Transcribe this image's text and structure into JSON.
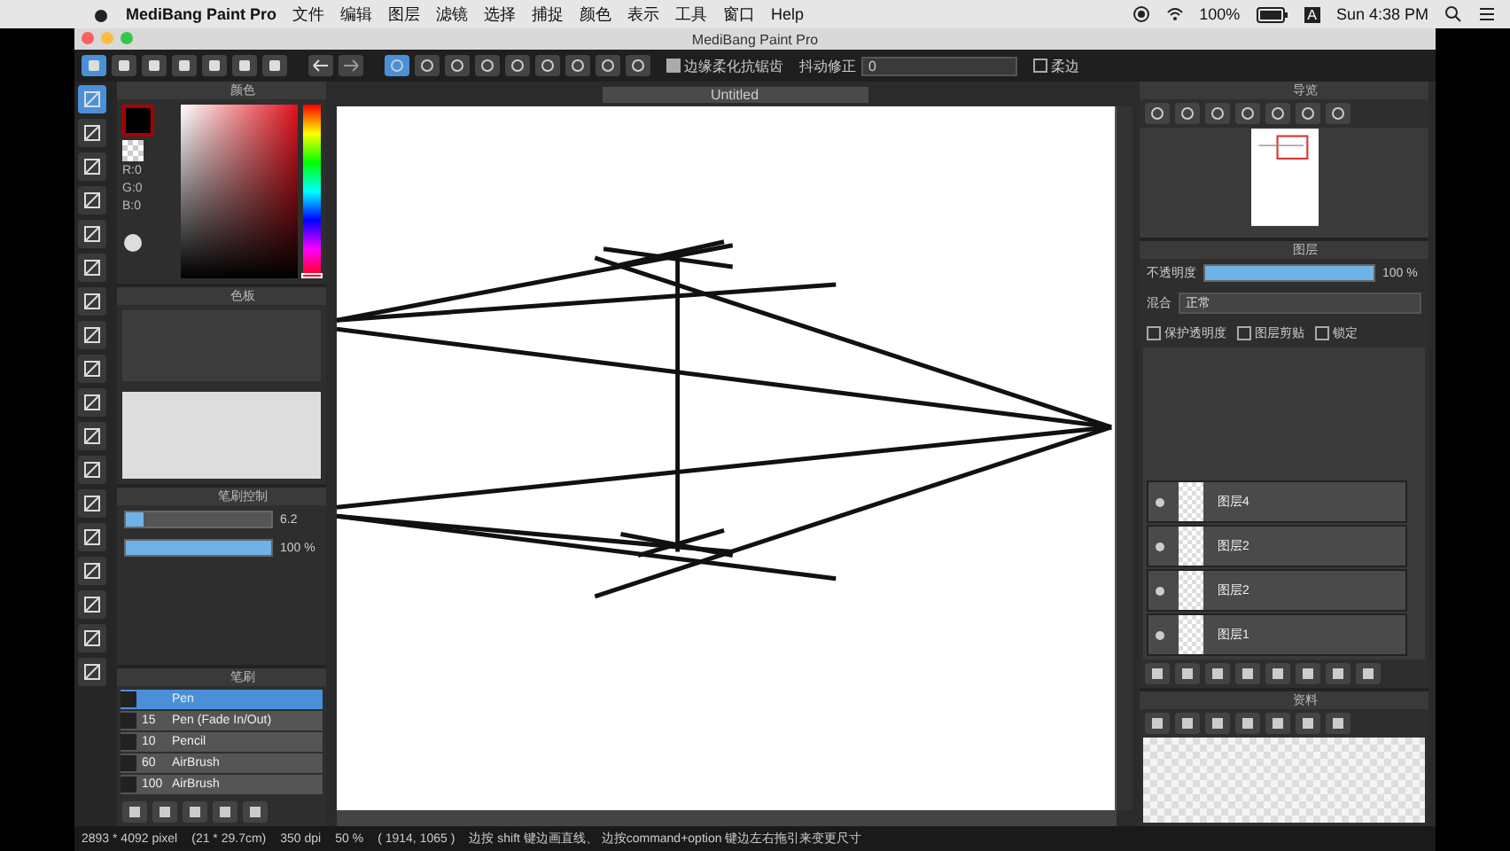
{
  "menu_bar": {
    "app_name": "MediBang Paint Pro",
    "menus": [
      "文件",
      "编辑",
      "图层",
      "滤镜",
      "选择",
      "捕捉",
      "颜色",
      "表示",
      "工具",
      "窗口",
      "Help"
    ],
    "battery": "100%",
    "input_source": "A",
    "clock": "Sun 4:38 PM"
  },
  "window": {
    "title": "MediBang Paint Pro"
  },
  "toolbar": {
    "antialias": {
      "label": "边缘柔化抗锯齿",
      "checked": true
    },
    "stabilizer": {
      "label": "抖动修正",
      "value": "0"
    },
    "soft_edge": {
      "label": "柔边",
      "checked": false
    }
  },
  "color_panel": {
    "title": "颜色",
    "readouts": [
      "R:0",
      "G:0",
      "B:0"
    ],
    "hue": {
      "level": 0
    }
  },
  "palette_panel": {
    "title": "色板"
  },
  "brush_control": {
    "title": "笔刷控制",
    "sliders": [
      {
        "level": 0.12,
        "reading": "6.2"
      },
      {
        "level": 1,
        "reading": "100 %"
      }
    ]
  },
  "brush_panel": {
    "title": "笔刷",
    "brushes": [
      {
        "name": "Pen",
        "selected": true
      },
      {
        "size": "15",
        "name": "Pen (Fade In/Out)",
        "selected": false
      },
      {
        "size": "10",
        "name": "Pencil",
        "selected": false
      },
      {
        "size": "60",
        "name": "AirBrush",
        "selected": false
      },
      {
        "size": "100",
        "name": "AirBrush",
        "selected": false
      }
    ]
  },
  "canvas": {
    "tab": "Untitled"
  },
  "navigator": {
    "title": "导览"
  },
  "layer_panel": {
    "title": "图层",
    "opacity_label": "不透明度",
    "opacity": {
      "level": 1,
      "reading": "100 %"
    },
    "blend_label": "混合",
    "blend_mode": "正常",
    "options": [
      {
        "label": "保护透明度",
        "checked": false
      },
      {
        "label": "图层剪贴",
        "checked": false
      },
      {
        "label": "锁定",
        "checked": false
      }
    ],
    "layers": [
      {
        "name": "图层4",
        "selected": false
      },
      {
        "name": "图层2",
        "selected": false
      },
      {
        "name": "图层2",
        "selected": false
      },
      {
        "name": "图层1",
        "selected": false
      }
    ]
  },
  "resource_panel": {
    "title": "资料"
  },
  "status_bar": {
    "items": [
      "2893 * 4092 pixel",
      "(21 * 29.7cm)",
      "350 dpi",
      "50 %",
      "( 1914, 1065 )",
      "边按 shift 键边画直线、 边按command+option 键边左右拖引来变更尺寸"
    ]
  }
}
